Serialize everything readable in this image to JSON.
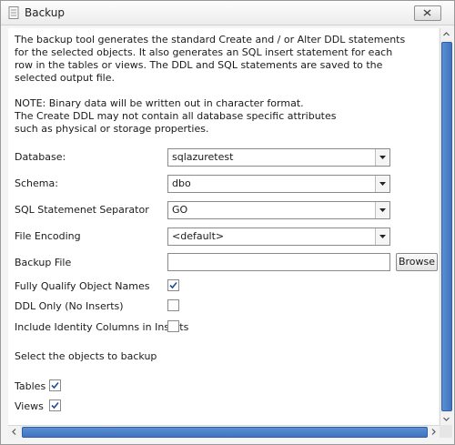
{
  "window": {
    "title": "Backup"
  },
  "description": {
    "lines": [
      "The backup tool generates the standard Create and / or Alter DDL statements",
      "for the selected objects. It also generates an SQL insert statement for each",
      "row in the tables or views. The DDL and SQL statements are saved to the",
      "selected output file."
    ],
    "note_lines": [
      "NOTE: Binary data will be written out in character format.",
      "The Create DDL may not contain all database specific attributes",
      "such as physical or storage properties."
    ]
  },
  "form": {
    "database": {
      "label": "Database:",
      "value": "sqlazuretest"
    },
    "schema": {
      "label": "Schema:",
      "value": "dbo"
    },
    "separator": {
      "label": "SQL Statemenet Separator",
      "value": "GO"
    },
    "encoding": {
      "label": "File Encoding",
      "value": "<default>"
    },
    "backup_file": {
      "label": "Backup File",
      "value": "",
      "browse_label": "Browse"
    },
    "fully_qualify": {
      "label": "Fully Qualify Object Names",
      "checked": true
    },
    "ddl_only": {
      "label": "DDL Only (No Inserts)",
      "checked": false
    },
    "identity_cols": {
      "label": "Include Identity Columns in Inserts",
      "checked": false
    },
    "objects_heading": "Select the objects to backup",
    "tables": {
      "label": "Tables",
      "checked": true
    },
    "views": {
      "label": "Views",
      "checked": true
    }
  },
  "icons": {
    "window": "document-icon",
    "close": "close-icon",
    "dropdown": "chevron-down-icon",
    "check": "checkmark-icon"
  },
  "colors": {
    "scroll_thumb": "#4a80cc",
    "check": "#1f4f9a"
  }
}
